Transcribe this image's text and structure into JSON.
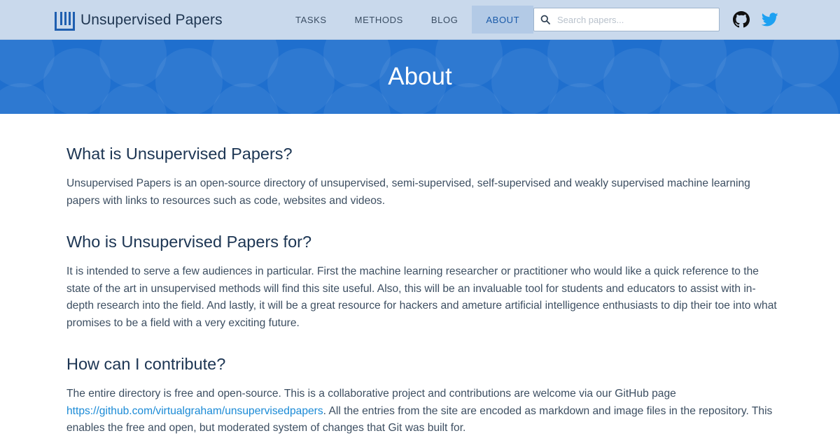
{
  "brand": {
    "name": "Unsupervised Papers"
  },
  "nav": {
    "links": [
      "TASKS",
      "METHODS",
      "BLOG",
      "ABOUT"
    ],
    "active": "ABOUT"
  },
  "search": {
    "placeholder": "Search papers..."
  },
  "social": {
    "icons": [
      "github-icon",
      "twitter-icon"
    ]
  },
  "hero": {
    "title": "About"
  },
  "sections": {
    "what": {
      "heading": "What is Unsupervised Papers?",
      "text": "Unsupervised Papers is an open-source directory of unsupervised, semi-supervised, self-supervised and weakly supervised machine learning papers with links to resources such as code, websites and videos."
    },
    "who": {
      "heading": "Who is Unsupervised Papers for?",
      "text": "It is intended to serve a few audiences in particular. First the machine learning researcher or practitioner who would like a quick reference to the state of the art in unsupervised methods will find this site useful. Also, this will be an invaluable tool for students and educators to assist with in-depth research into the field. And lastly, it will be a great resource for hackers and ameture artificial intelligence enthusiasts to dip their toe into what promises to be a field with a very exciting future."
    },
    "how": {
      "heading": "How can I contribute?",
      "text_before": "The entire directory is free and open-source. This is a collaborative project and contributions are welcome via our GitHub page ",
      "link": "https://github.com/virtualgraham/unsupervisedpapers",
      "text_after": ". All the entries from the site are encoded as markdown and image files in the repository. This enables the free and open, but moderated system of changes that Git was built for."
    }
  },
  "colors": {
    "navbar": "#c9d9ec",
    "hero": "#1f6fce",
    "heading": "#1c3553",
    "link": "#1a8ad6",
    "active_nav": "#1a5aa8"
  }
}
